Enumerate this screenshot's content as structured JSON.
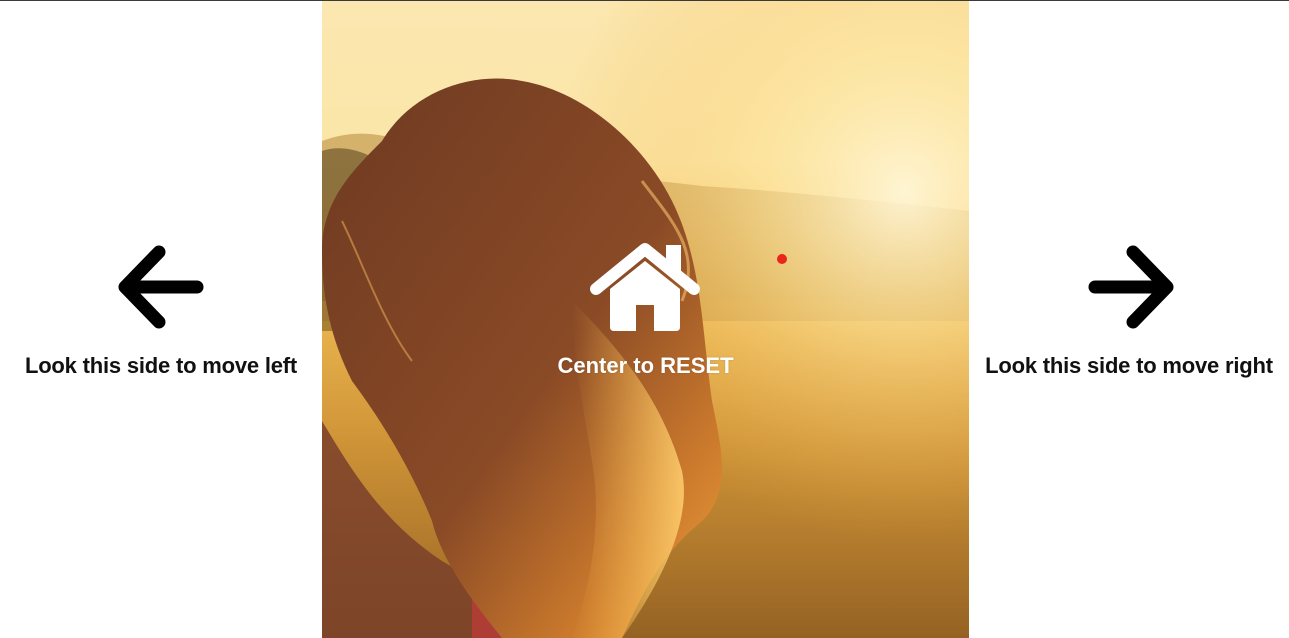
{
  "left_zone": {
    "label": "Look this side to move left",
    "icon": "arrow-left-icon"
  },
  "center_zone": {
    "label": "Center to RESET",
    "icon": "home-icon"
  },
  "right_zone": {
    "label": "Look this side to move right",
    "icon": "arrow-right-icon"
  },
  "gaze_indicator": {
    "color": "#e8261a"
  },
  "colors": {
    "text_dark": "#111111",
    "text_light": "#ffffff"
  }
}
